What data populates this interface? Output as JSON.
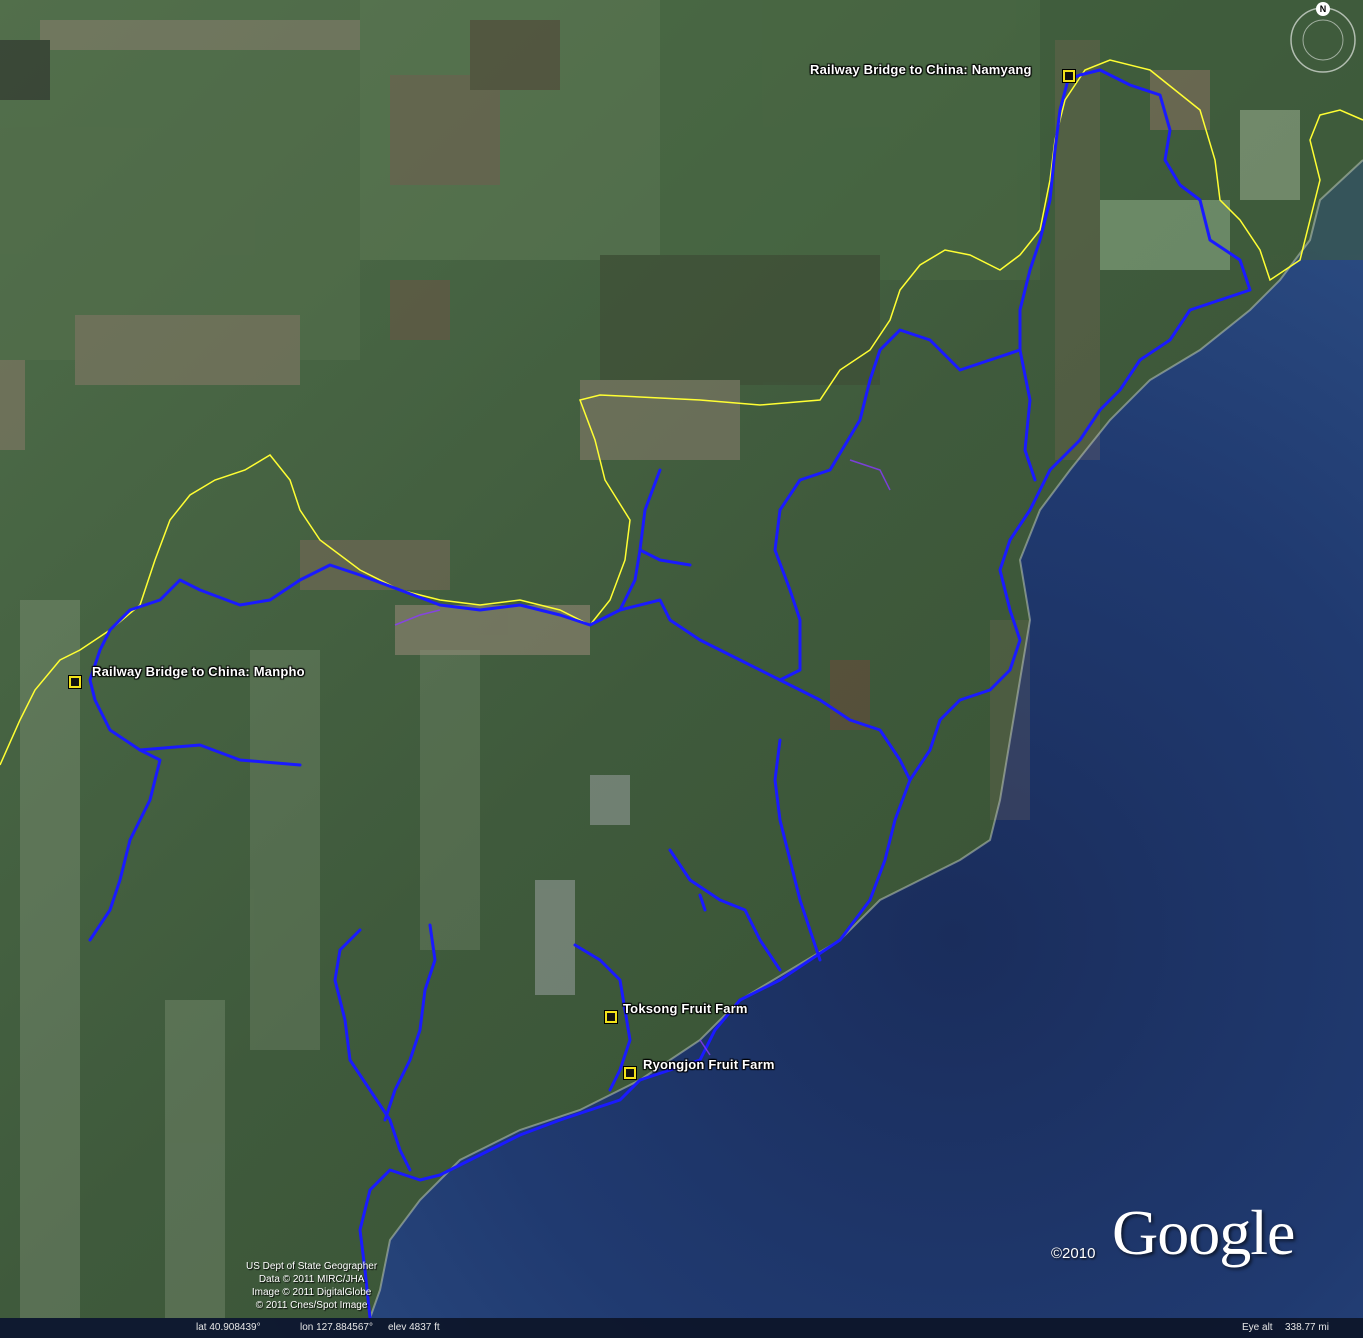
{
  "placemarks": [
    {
      "label": "Railway Bridge to China: Namyang"
    },
    {
      "label": "Railway Bridge to China: Manpho"
    },
    {
      "label": "Toksong Fruit Farm"
    },
    {
      "label": "Ryongjon Fruit Farm"
    }
  ],
  "credits": {
    "line1": "US Dept of State Geographer",
    "line2": "Data © 2011 MIRC/JHA",
    "line3": "Image © 2011 DigitalGlobe",
    "line4": "© 2011 Cnes/Spot Image"
  },
  "branding": {
    "copyright": "©2010",
    "logo": "Google"
  },
  "status": {
    "lat": "lat   40.908439°",
    "lon": "lon  127.884567°",
    "elev": "elev  4837 ft",
    "eye_alt_label": "Eye alt",
    "eye_alt_value": "338.77 mi"
  },
  "compass": {
    "north_label": "N"
  },
  "colors": {
    "rail_lines": "#1a1aff",
    "border": "#ffff33",
    "sea": "#1e3566",
    "land": "#3e5a3c"
  }
}
